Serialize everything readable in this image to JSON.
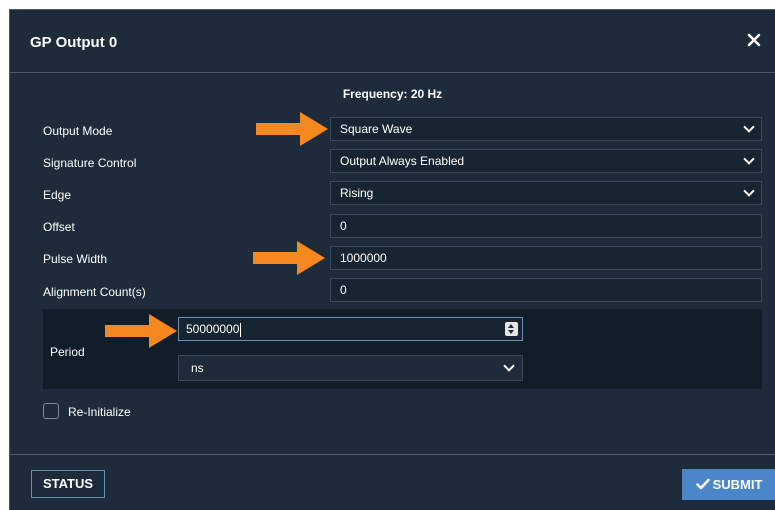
{
  "dialog": {
    "title": "GP Output 0",
    "close_glyph": "✕"
  },
  "frequency_text": "Frequency: 20 Hz",
  "fields": {
    "output_mode": {
      "label": "Output Mode",
      "value": "Square Wave"
    },
    "signature_control": {
      "label": "Signature Control",
      "value": "Output Always Enabled"
    },
    "edge": {
      "label": "Edge",
      "value": "Rising"
    },
    "offset": {
      "label": "Offset",
      "value": "0"
    },
    "pulse_width": {
      "label": "Pulse Width",
      "value": "1000000"
    },
    "alignment_count": {
      "label": "Alignment Count(s)",
      "value": "0"
    }
  },
  "period": {
    "label": "Period",
    "value": "50000000",
    "unit": "ns"
  },
  "reinitialize": {
    "label": "Re-Initialize",
    "checked": false
  },
  "footer": {
    "status_label": "STATUS",
    "submit_label": "SUBMIT"
  },
  "icons": {
    "close": "close-icon",
    "dropdown": "chevron-down-icon",
    "spinner": "spinner-icon",
    "submit_check": "check-icon",
    "annotation_arrow": "arrow-right-icon"
  },
  "colors": {
    "background": "#1d2b3a",
    "accent": "#4a86c8",
    "annotation": "#f5891f"
  }
}
